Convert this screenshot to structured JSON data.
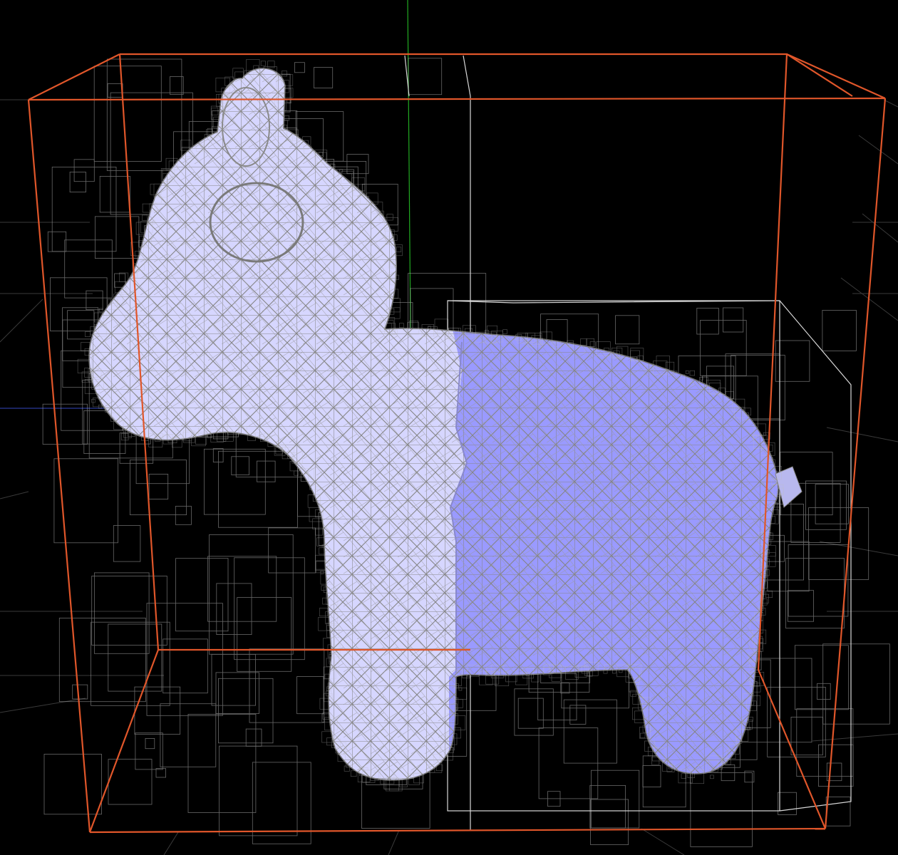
{
  "viewport": {
    "background": "#000000",
    "mesh_name": "toy-horse",
    "colors": {
      "grid": "#3a3a3a",
      "axis_y": "#22aa22",
      "axis_x": "#2a3a99",
      "root_box": "#e0562a",
      "child_box": "#d8d8d8",
      "octree_fine": "#bdbdbd",
      "mesh_light": "#d6d6ff",
      "mesh_selected": "#9a9aff",
      "wireframe": "#8a8a8a",
      "outline": "#707070"
    },
    "selection": {
      "selected_region": "body-rear"
    }
  }
}
